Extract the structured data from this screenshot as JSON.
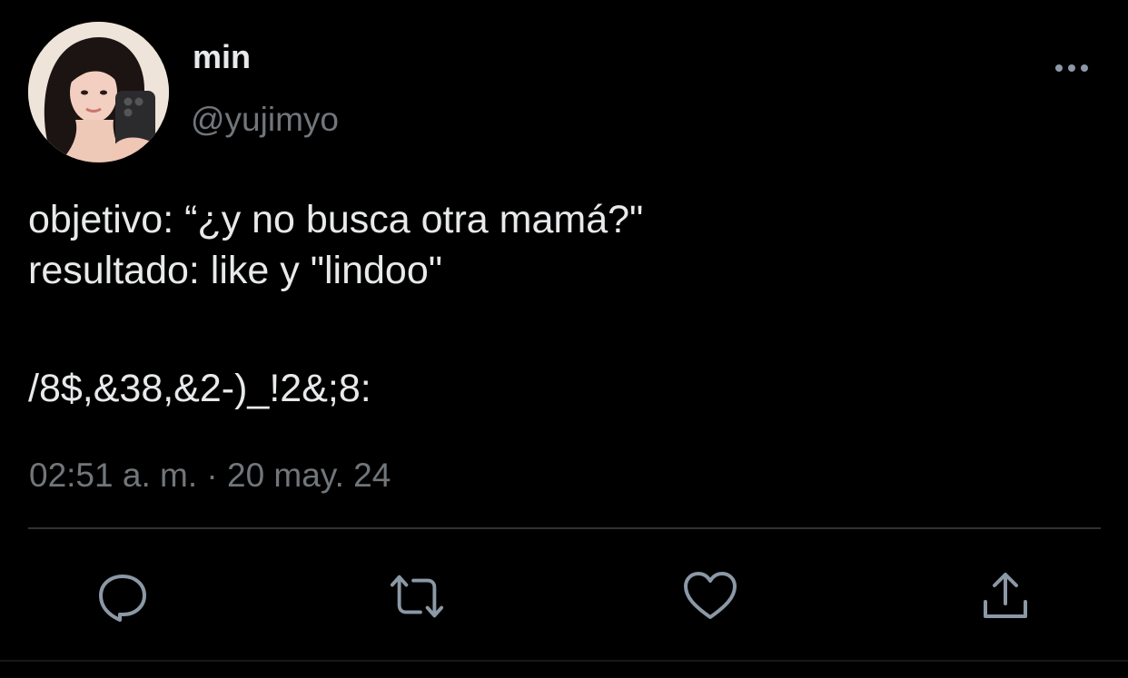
{
  "user": {
    "display_name": "min",
    "handle": "@yujimyo"
  },
  "tweet": {
    "lines": [
      "objetivo: “¿y no busca otra mamá?\"",
      "resultado: like y \"lindoo\"",
      "/8$,&38,&2-)_!2&;8:"
    ],
    "time": "02:51 a. m.",
    "separator": "·",
    "date": "20 may. 24"
  },
  "actions": [
    {
      "icon": "reply-icon"
    },
    {
      "icon": "retweet-icon"
    },
    {
      "icon": "like-icon"
    },
    {
      "icon": "share-icon"
    }
  ],
  "menu": {
    "icon": "more-options-icon"
  },
  "colors": {
    "background": "#000000",
    "primary_text": "#e7e9ea",
    "secondary_text": "#71767b",
    "icon": "#8b98a5",
    "divider": "#2f3336"
  }
}
